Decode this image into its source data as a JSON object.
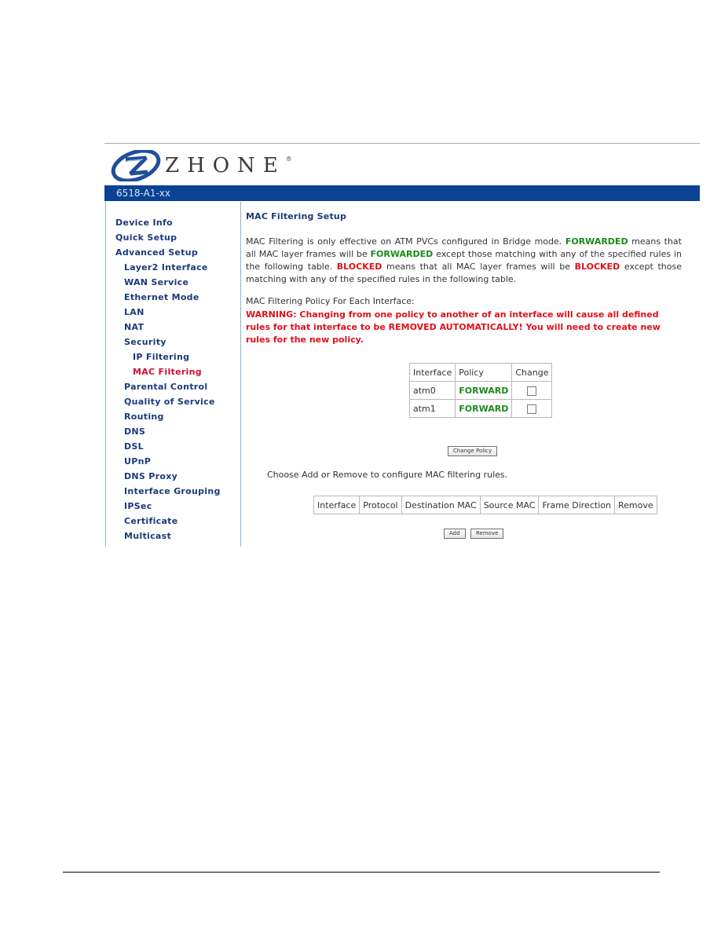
{
  "header": {
    "brand": "ZHONE",
    "brand_mark": "®",
    "model": "6518-A1-xx"
  },
  "sidebar": {
    "items": [
      {
        "label": "Device Info",
        "level": 0
      },
      {
        "label": "Quick Setup",
        "level": 0
      },
      {
        "label": "Advanced Setup",
        "level": 0
      },
      {
        "label": "Layer2 Interface",
        "level": 1
      },
      {
        "label": "WAN Service",
        "level": 1
      },
      {
        "label": "Ethernet Mode",
        "level": 1
      },
      {
        "label": "LAN",
        "level": 1
      },
      {
        "label": "NAT",
        "level": 1
      },
      {
        "label": "Security",
        "level": 1
      },
      {
        "label": "IP Filtering",
        "level": 2
      },
      {
        "label": "MAC Filtering",
        "level": 2,
        "active": true
      },
      {
        "label": "Parental Control",
        "level": 1
      },
      {
        "label": "Quality of Service",
        "level": 1
      },
      {
        "label": "Routing",
        "level": 1
      },
      {
        "label": "DNS",
        "level": 1
      },
      {
        "label": "DSL",
        "level": 1
      },
      {
        "label": "UPnP",
        "level": 1
      },
      {
        "label": "DNS Proxy",
        "level": 1
      },
      {
        "label": "Interface Grouping",
        "level": 1
      },
      {
        "label": "IPSec",
        "level": 1
      },
      {
        "label": "Certificate",
        "level": 1
      },
      {
        "label": "Multicast",
        "level": 1
      }
    ]
  },
  "main": {
    "title": "MAC Filtering Setup",
    "desc": {
      "p1": "MAC Filtering is only effective on ATM PVCs configured in Bridge mode. ",
      "fw1": "FORWARDED",
      "p2": " means that all MAC layer frames will be ",
      "fw2": "FORWARDED",
      "p3": " except those matching with any of the specified rules in the following table. ",
      "bl1": "BLOCKED",
      "p4": " means that all MAC layer frames will be ",
      "bl2": "BLOCKED",
      "p5": " except those matching with any of the specified rules in the following table."
    },
    "policy_label": "MAC Filtering Policy For Each Interface:",
    "warning": "WARNING: Changing from one policy to another of an interface will cause all defined rules for that interface to be REMOVED AUTOMATICALLY! You will need to create new rules for the new policy.",
    "policy_table": {
      "headers": [
        "Interface",
        "Policy",
        "Change"
      ],
      "rows": [
        {
          "interface": "atm0",
          "policy": "FORWARD",
          "change": false
        },
        {
          "interface": "atm1",
          "policy": "FORWARD",
          "change": false
        }
      ]
    },
    "change_policy_label": "Change Policy",
    "choose_text": "Choose Add or Remove to configure MAC filtering rules.",
    "rules_table": {
      "headers": [
        "Interface",
        "Protocol",
        "Destination MAC",
        "Source MAC",
        "Frame Direction",
        "Remove"
      ]
    },
    "add_label": "Add",
    "remove_label": "Remove"
  },
  "colors": {
    "brand_blue": "#0b4293",
    "nav_text": "#1c3a7a",
    "active": "#d0103a",
    "forward_green": "#1a8a1a",
    "blocked_red": "#e0101a"
  }
}
